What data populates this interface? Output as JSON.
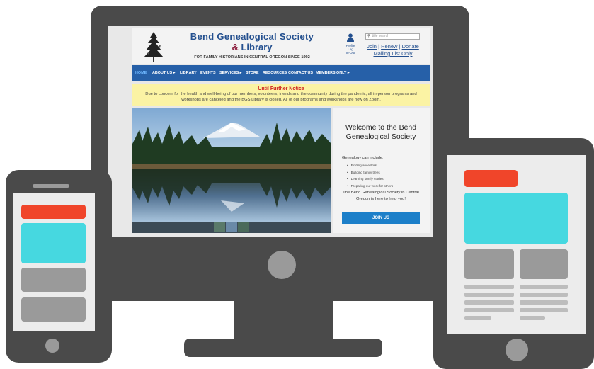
{
  "site": {
    "title_line1": "Bend Genealogical Society",
    "title_line2_amp": "&",
    "title_line2_rest": " Library",
    "tagline": "FOR FAMILY HISTORIANS IN CENTRAL OREGON SINCE 1992",
    "profile": {
      "line1": "Profile",
      "line2": "Log",
      "line3": "In-Out"
    },
    "search_placeholder": "title search",
    "links": {
      "join": "Join",
      "renew": "Renew",
      "donate": "Donate",
      "mailing": "Mailing List Only",
      "sep": " | "
    }
  },
  "nav": {
    "items": [
      "HOME",
      "ABOUT US ▸",
      "LIBRARY",
      "EVENTS",
      "SERVICES ▸",
      "STORE",
      "RESOURCES",
      "CONTACT US",
      "MEMBERS ONLY ▸"
    ],
    "active_index": 0
  },
  "notice": {
    "title": "Until Further Notice",
    "body": "Due to concern for the health and well-being of our members, volunteers, friends and the community during the pandemic, all in-person programs and workshops are canceled and the BGS Library is closed. All of our programs and workshops are now on Zoom."
  },
  "welcome": {
    "title": "Welcome to the Bend Genealogical Society",
    "label": "Genealogy can include:",
    "list": [
      "Finding ancestors",
      "Building family trees",
      "Learning family stories",
      "Preparing our work for others"
    ],
    "help": "The Bend Genealogical Society in Central Oregon is here to help you!",
    "join_button": "JOIN US"
  },
  "colors": {
    "device": "#4a4a4a",
    "nav_blue": "#2660a8",
    "title_blue": "#24508f",
    "notice_bg": "#fbf3a4",
    "join_blue": "#1c7fc9",
    "red": "#f0452a",
    "cyan": "#46d8e0"
  },
  "icons": [
    "tree-logo-icon",
    "user-profile-icon",
    "search-icon",
    "chevron-right-icon",
    "home-button-icon",
    "speaker-icon"
  ]
}
